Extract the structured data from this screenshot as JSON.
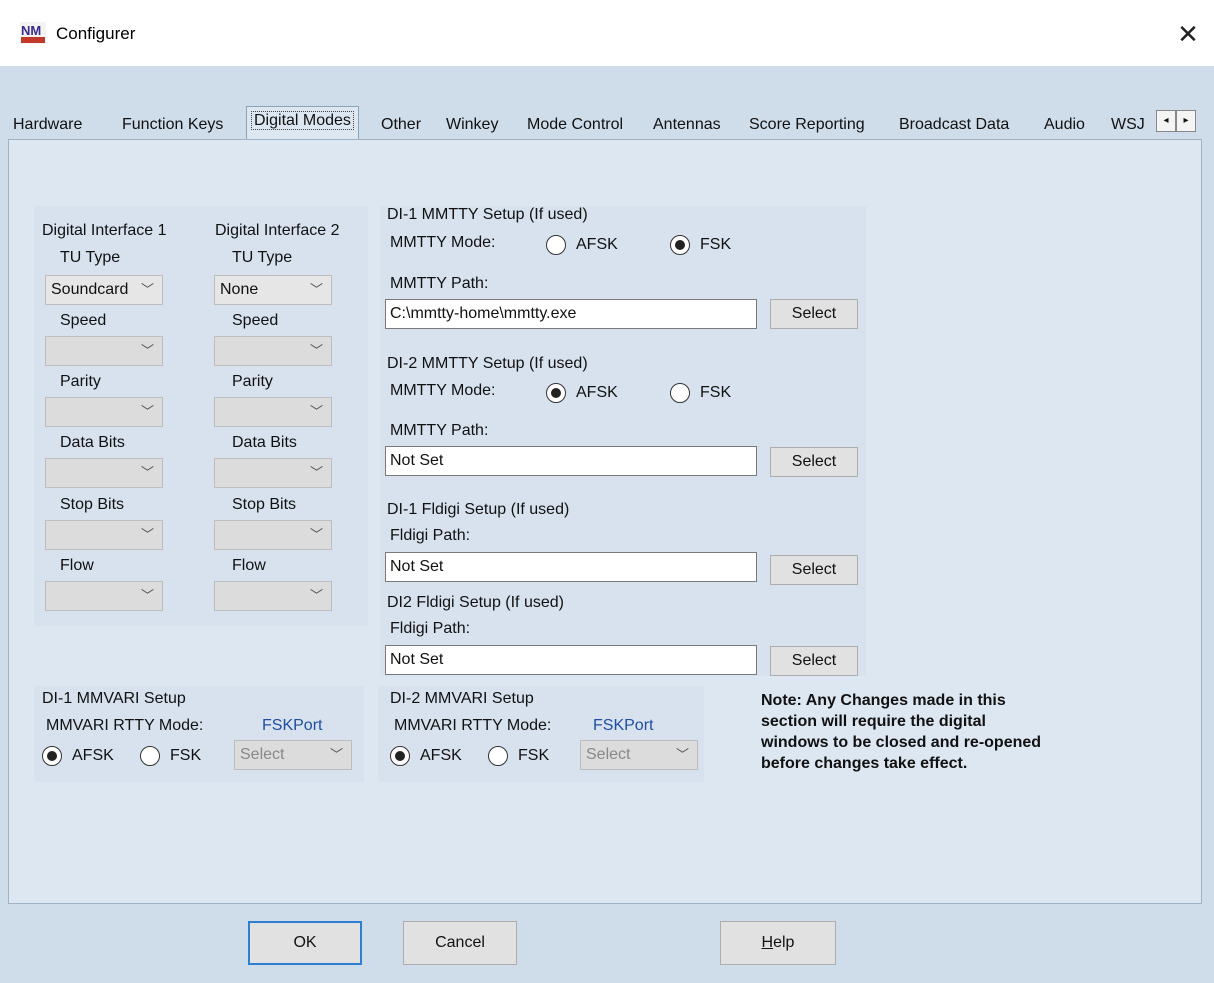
{
  "window": {
    "title": "Configurer",
    "close_glyph": "✕",
    "logo_text": "N1MM"
  },
  "tabs": [
    {
      "label": "Hardware"
    },
    {
      "label": "Function Keys"
    },
    {
      "label": "Digital Modes",
      "active": true
    },
    {
      "label": "Other"
    },
    {
      "label": "Winkey"
    },
    {
      "label": "Mode Control"
    },
    {
      "label": "Antennas"
    },
    {
      "label": "Score Reporting"
    },
    {
      "label": "Broadcast Data"
    },
    {
      "label": "Audio"
    },
    {
      "label": "WSJ"
    }
  ],
  "tab_scroll": {
    "left": "◂",
    "right": "▸"
  },
  "di": [
    {
      "heading": "Digital Interface 1",
      "tu_label": "TU Type",
      "tu_value": "Soundcard",
      "speed_label": "Speed",
      "parity_label": "Parity",
      "databits_label": "Data Bits",
      "stopbits_label": "Stop Bits",
      "flow_label": "Flow"
    },
    {
      "heading": "Digital Interface 2",
      "tu_label": "TU Type",
      "tu_value": "None",
      "speed_label": "Speed",
      "parity_label": "Parity",
      "databits_label": "Data Bits",
      "stopbits_label": "Stop Bits",
      "flow_label": "Flow"
    }
  ],
  "mmtty1": {
    "heading": "DI-1 MMTTY Setup (If used)",
    "mode_label": "MMTTY Mode:",
    "afsk_label": "AFSK",
    "fsk_label": "FSK",
    "selected": "FSK",
    "path_label": "MMTTY Path:",
    "path_value": "C:\\mmtty-home\\mmtty.exe",
    "select_label": "Select"
  },
  "mmtty2": {
    "heading": "DI-2 MMTTY Setup (If used)",
    "mode_label": "MMTTY Mode:",
    "afsk_label": "AFSK",
    "fsk_label": "FSK",
    "selected": "AFSK",
    "path_label": "MMTTY Path:",
    "path_value": "Not Set",
    "select_label": "Select"
  },
  "fldigi1": {
    "heading": "DI-1 Fldigi Setup (If used)",
    "path_label": "Fldigi Path:",
    "path_value": "Not Set",
    "select_label": "Select"
  },
  "fldigi2": {
    "heading": "DI2 Fldigi Setup (If used)",
    "path_label": "Fldigi Path:",
    "path_value": "Not Set",
    "select_label": "Select"
  },
  "mmvari1": {
    "heading": "DI-1 MMVARI Setup",
    "mode_label": "MMVARI RTTY Mode:",
    "fskport_label": "FSKPort",
    "afsk_label": "AFSK",
    "fsk_label": "FSK",
    "selected": "AFSK",
    "port_value": "Select"
  },
  "mmvari2": {
    "heading": "DI-2 MMVARI Setup",
    "mode_label": "MMVARI RTTY Mode:",
    "fskport_label": "FSKPort",
    "afsk_label": "AFSK",
    "fsk_label": "FSK",
    "selected": "AFSK",
    "port_value": "Select"
  },
  "note": {
    "line1": "Note: Any Changes made in this",
    "line2": "section will require the digital",
    "line3": "windows to be closed and re-opened",
    "line4": "before changes take effect."
  },
  "footer": {
    "ok": "OK",
    "cancel": "Cancel",
    "help_h": "H",
    "help_rest": "elp"
  },
  "chevron": "﹀",
  "colors": {
    "background": "#cfdcea",
    "panel": "#dde7f1",
    "fskport_label": "#1f4fa0"
  }
}
